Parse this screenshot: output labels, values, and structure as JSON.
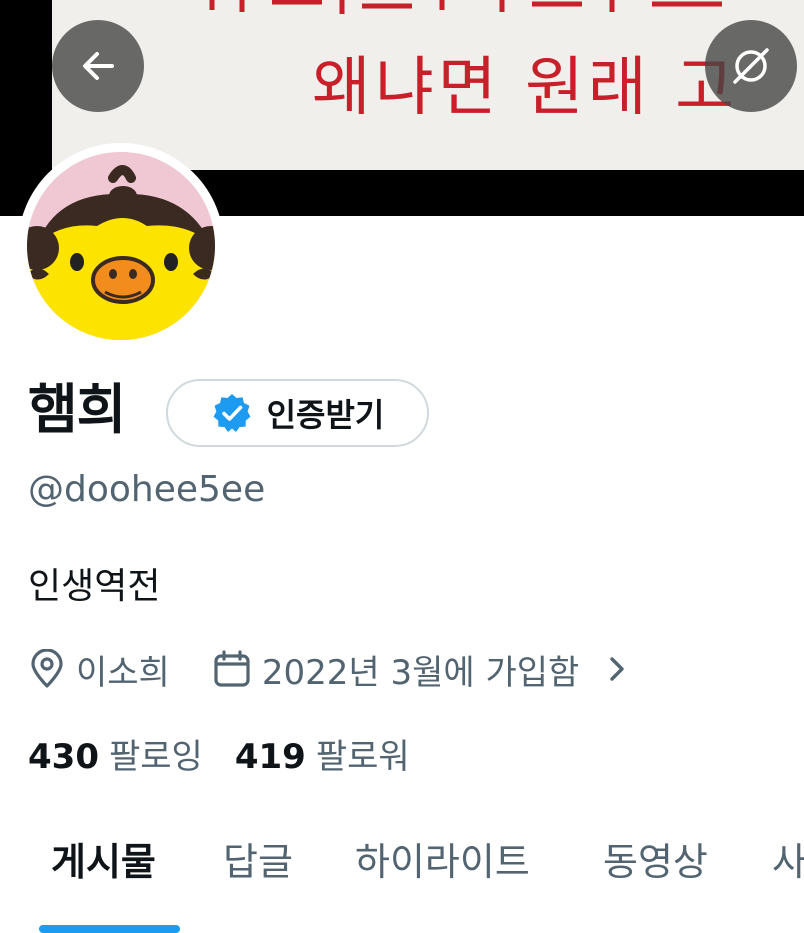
{
  "banner": {
    "text": "왜냐면 원래 고",
    "text_color": "#c8202a"
  },
  "toolbar": {
    "back_icon": "arrow-left-icon",
    "extra_icon": "circle-slash-icon"
  },
  "profile": {
    "display_name": "햄희",
    "verify_button_label": "인증받기",
    "verify_icon": "verified-badge-icon",
    "handle": "@doohee5ee",
    "bio": "인생역전",
    "location": "이소희",
    "joined": "2022년 3월에 가입함",
    "accent_color": "#1d9bf0"
  },
  "stats": {
    "following_count": "430",
    "following_label": "팔로잉",
    "followers_count": "419",
    "followers_label": "팔로워"
  },
  "tabs": [
    {
      "label": "게시물",
      "active": true
    },
    {
      "label": "답글",
      "active": false
    },
    {
      "label": "하이라이트",
      "active": false
    },
    {
      "label": "동영상",
      "active": false
    },
    {
      "label": "사",
      "active": false
    }
  ]
}
